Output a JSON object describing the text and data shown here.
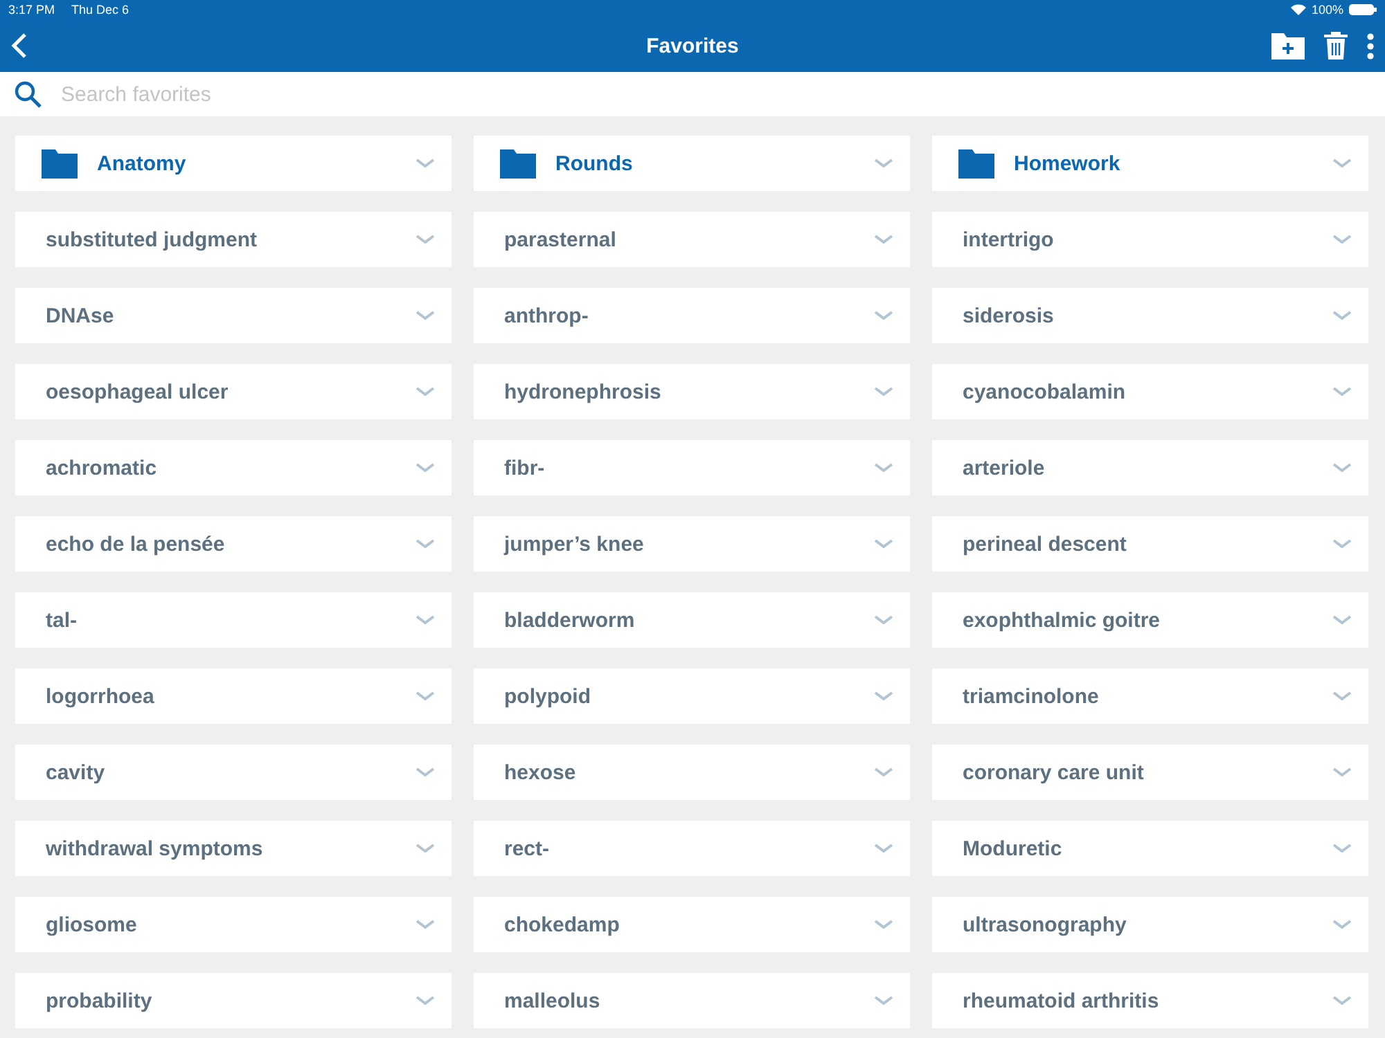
{
  "status_bar": {
    "time": "3:17 PM",
    "date": "Thu Dec 6",
    "battery": "100%"
  },
  "nav": {
    "title": "Favorites"
  },
  "search": {
    "placeholder": "Search favorites"
  },
  "items": [
    {
      "kind": "folder",
      "label": "Anatomy"
    },
    {
      "kind": "folder",
      "label": "Rounds"
    },
    {
      "kind": "folder",
      "label": "Homework"
    },
    {
      "kind": "term",
      "label": "substituted judgment"
    },
    {
      "kind": "term",
      "label": "parasternal"
    },
    {
      "kind": "term",
      "label": "intertrigo"
    },
    {
      "kind": "term",
      "label": "DNAse"
    },
    {
      "kind": "term",
      "label": "anthrop-"
    },
    {
      "kind": "term",
      "label": "siderosis"
    },
    {
      "kind": "term",
      "label": "oesophageal ulcer"
    },
    {
      "kind": "term",
      "label": "hydronephrosis"
    },
    {
      "kind": "term",
      "label": "cyanocobalamin"
    },
    {
      "kind": "term",
      "label": "achromatic"
    },
    {
      "kind": "term",
      "label": "fibr-"
    },
    {
      "kind": "term",
      "label": "arteriole"
    },
    {
      "kind": "term",
      "label": "echo de la pensée"
    },
    {
      "kind": "term",
      "label": "jumper’s knee"
    },
    {
      "kind": "term",
      "label": "perineal descent"
    },
    {
      "kind": "term",
      "label": "tal-"
    },
    {
      "kind": "term",
      "label": "bladderworm"
    },
    {
      "kind": "term",
      "label": "exophthalmic goitre"
    },
    {
      "kind": "term",
      "label": "logorrhoea"
    },
    {
      "kind": "term",
      "label": "polypoid"
    },
    {
      "kind": "term",
      "label": "triamcinolone"
    },
    {
      "kind": "term",
      "label": "cavity"
    },
    {
      "kind": "term",
      "label": "hexose"
    },
    {
      "kind": "term",
      "label": "coronary care unit"
    },
    {
      "kind": "term",
      "label": "withdrawal symptoms"
    },
    {
      "kind": "term",
      "label": "rect-"
    },
    {
      "kind": "term",
      "label": "Moduretic"
    },
    {
      "kind": "term",
      "label": "gliosome"
    },
    {
      "kind": "term",
      "label": "chokedamp"
    },
    {
      "kind": "term",
      "label": "ultrasonography"
    },
    {
      "kind": "term",
      "label": "probability"
    },
    {
      "kind": "term",
      "label": "malleolus"
    },
    {
      "kind": "term",
      "label": "rheumatoid arthritis"
    }
  ]
}
